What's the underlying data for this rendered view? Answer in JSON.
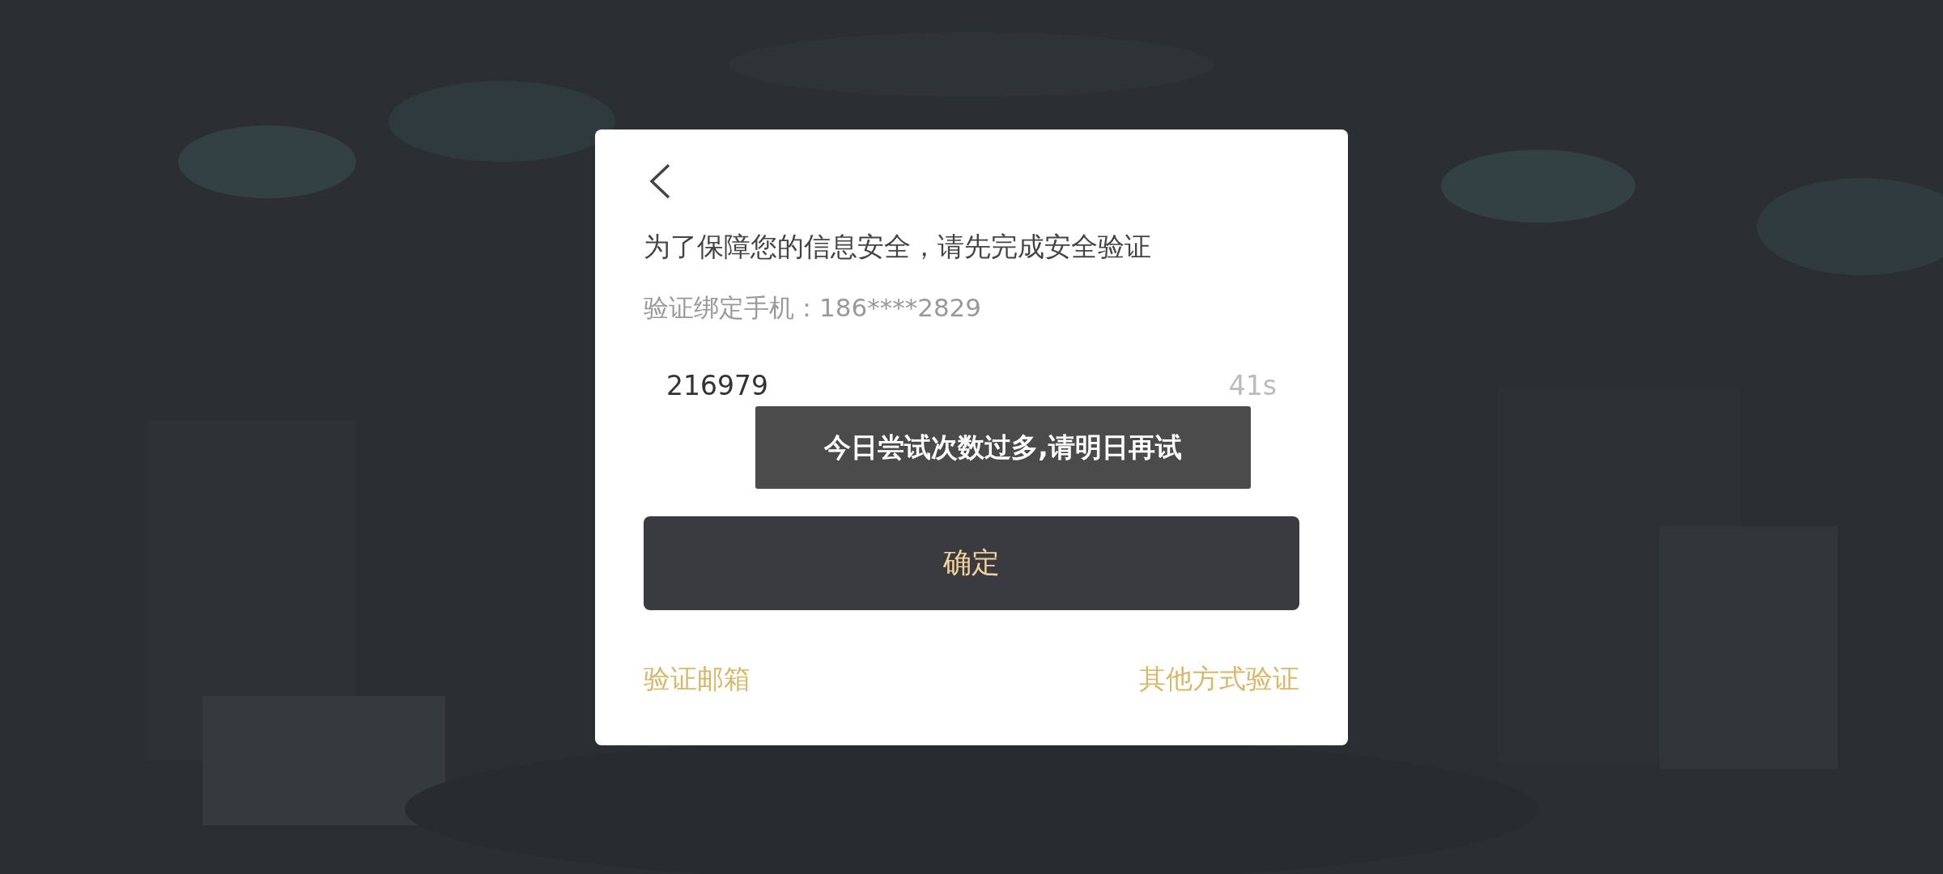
{
  "dialog": {
    "title": "为了保障您的信息安全，请先完成安全验证",
    "subtitle": "验证绑定手机：186****2829",
    "code_field": {
      "value": "216979",
      "countdown": "41s"
    },
    "confirm_button": "确定",
    "links": [
      "验证邮箱",
      "其他方式验证"
    ]
  },
  "toast": "今日尝试次数过多,请明日再试"
}
